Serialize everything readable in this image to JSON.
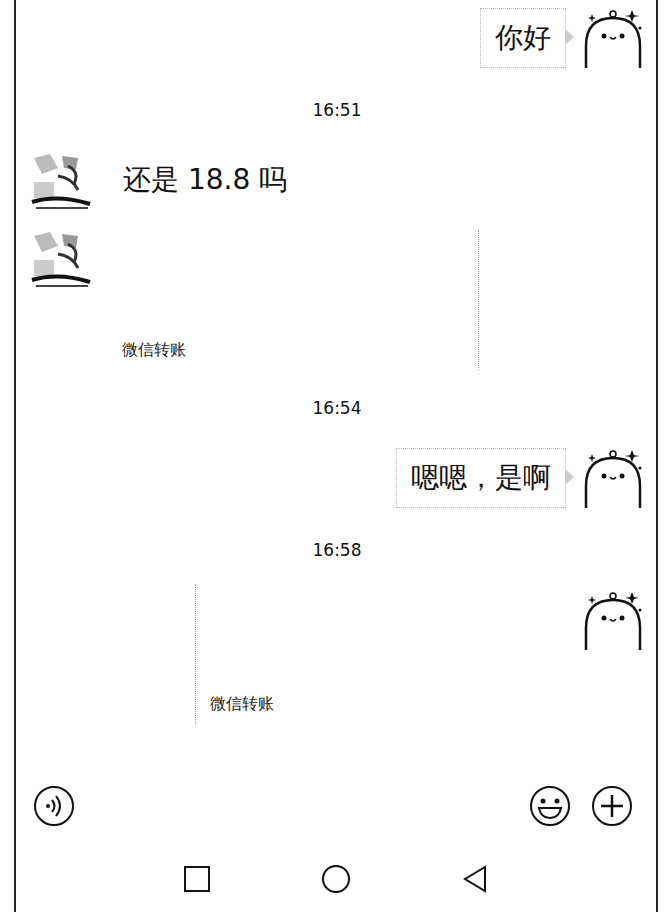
{
  "messages": [
    {
      "kind": "text",
      "side": "right",
      "text": "你好"
    },
    {
      "kind": "time",
      "text": "16:51"
    },
    {
      "kind": "text",
      "side": "left",
      "text": "还是 18.8 吗"
    },
    {
      "kind": "transfer",
      "side": "left",
      "label": "微信转账"
    },
    {
      "kind": "time",
      "text": "16:54"
    },
    {
      "kind": "text",
      "side": "right",
      "text": "嗯嗯，是啊"
    },
    {
      "kind": "time",
      "text": "16:58"
    },
    {
      "kind": "transfer",
      "side": "right",
      "label": "微信转账"
    }
  ]
}
